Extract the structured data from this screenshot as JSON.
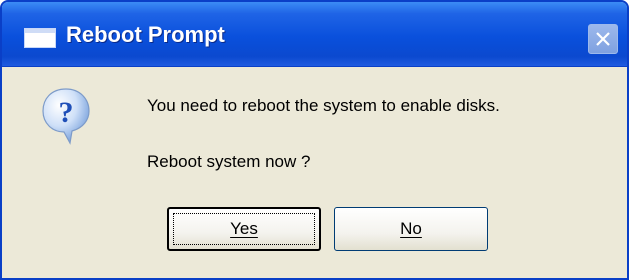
{
  "window": {
    "title": "Reboot Prompt",
    "title_icon": "window-icon",
    "close_icon": "close-icon"
  },
  "dialog": {
    "icon": "question-icon",
    "message": "You need to reboot the system to enable disks.",
    "question": "Reboot system now ?"
  },
  "buttons": {
    "yes_label": "Yes",
    "no_label": "No"
  },
  "colors": {
    "titlebar": "#0a50dc",
    "dialog_bg": "#ece9d8",
    "icon_blue": "#1f4fb8"
  }
}
